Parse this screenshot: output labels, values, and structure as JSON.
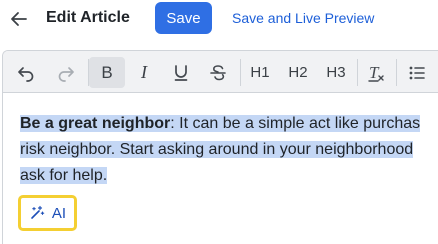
{
  "header": {
    "title": "Edit Article",
    "save_label": "Save",
    "preview_label": "Save and Live Preview"
  },
  "toolbar": {
    "items": [
      {
        "name": "undo-icon"
      },
      {
        "name": "redo-icon"
      },
      {
        "name": "bold-icon",
        "label": "B",
        "active": true
      },
      {
        "name": "italic-icon",
        "label": "I"
      },
      {
        "name": "underline-icon",
        "label": "U"
      },
      {
        "name": "strikethrough-icon",
        "label": "S"
      },
      {
        "name": "heading-1",
        "label": "H1"
      },
      {
        "name": "heading-2",
        "label": "H2"
      },
      {
        "name": "heading-3",
        "label": "H3"
      },
      {
        "name": "clear-format-icon",
        "label": "T"
      },
      {
        "name": "bullet-list-icon"
      }
    ]
  },
  "content": {
    "bold_lead": "Be a great neighbor",
    "line1_rest": ": It can be a simple act like purchas",
    "line2": "risk neighbor. Start asking around in your neighborhood",
    "line3": "ask for help."
  },
  "ai": {
    "label": "AI"
  },
  "colors": {
    "primary": "#2f6fe4",
    "link": "#1d5fd8",
    "selection": "#c4d7f5",
    "focus_ring": "#f4cf32"
  }
}
